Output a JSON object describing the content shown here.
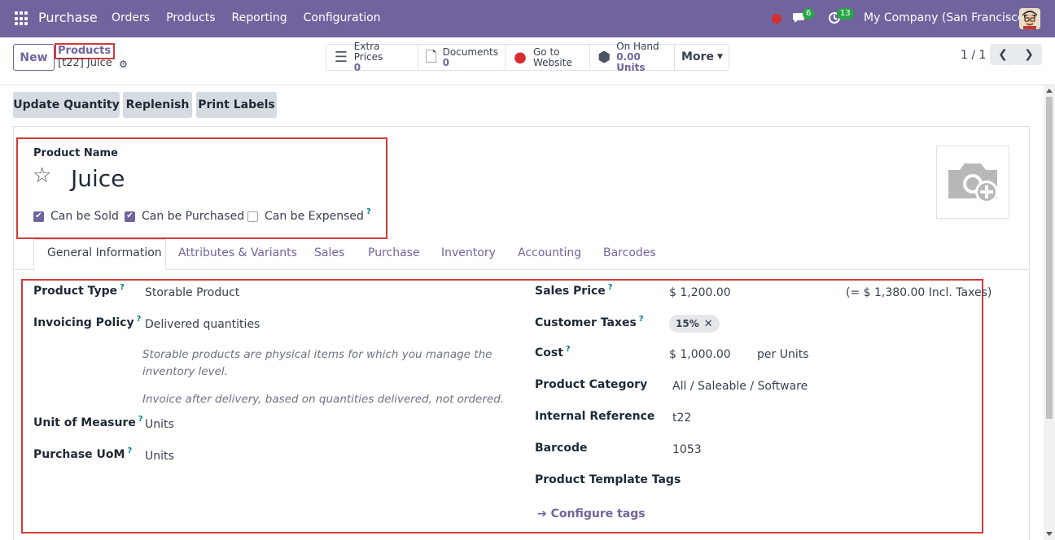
{
  "navbar": {
    "app_name": "Purchase",
    "menu": [
      "Orders",
      "Products",
      "Reporting",
      "Configuration"
    ],
    "chat_count": "6",
    "activity_count": "13",
    "company": "My Company (San Francisco)",
    "accent": "#71639e"
  },
  "control": {
    "new_label": "New",
    "breadcrumb_parent": "Products",
    "breadcrumb_current": "[t22] Juice",
    "smart_buttons": {
      "extra_prices_label": "Extra Prices",
      "extra_prices_value": "0",
      "documents_label": "Documents",
      "documents_value": "0",
      "website_line1": "Go to",
      "website_line2": "Website",
      "on_hand_label": "On Hand",
      "on_hand_value": "0.00 Units",
      "more_label": "More"
    },
    "pager": "1 / 1"
  },
  "status_buttons": {
    "update_quantity": "Update Quantity",
    "replenish": "Replenish",
    "print_labels": "Print Labels"
  },
  "form": {
    "product_name_label": "Product Name",
    "product_name": "Juice",
    "can_be_sold": "Can be Sold",
    "can_be_purchased": "Can be Purchased",
    "can_be_expensed": "Can be Expensed",
    "help_mark": "?",
    "tabs": [
      "General Information",
      "Attributes & Variants",
      "Sales",
      "Purchase",
      "Inventory",
      "Accounting",
      "Barcodes"
    ],
    "left": {
      "product_type_label": "Product Type",
      "product_type": "Storable Product",
      "invoicing_policy_label": "Invoicing Policy",
      "invoicing_policy": "Delivered quantities",
      "hint_storable": "Storable products are physical items for which you manage the inventory level.",
      "hint_invoice": "Invoice after delivery, based on quantities delivered, not ordered.",
      "uom_label": "Unit of Measure",
      "uom": "Units",
      "purchase_uom_label": "Purchase UoM",
      "purchase_uom": "Units"
    },
    "right": {
      "sales_price_label": "Sales Price",
      "sales_price": "$ 1,200.00",
      "sales_price_incl": "(= $ 1,380.00 Incl. Taxes)",
      "customer_taxes_label": "Customer Taxes",
      "customer_tax_tag": "15%",
      "cost_label": "Cost",
      "cost": "$ 1,000.00",
      "cost_per": "per Units",
      "category_label": "Product Category",
      "category": "All / Saleable / Software",
      "internal_ref_label": "Internal Reference",
      "internal_ref": "t22",
      "barcode_label": "Barcode",
      "barcode": "1053",
      "tags_label": "Product Template Tags",
      "configure_tags": "Configure tags"
    }
  }
}
